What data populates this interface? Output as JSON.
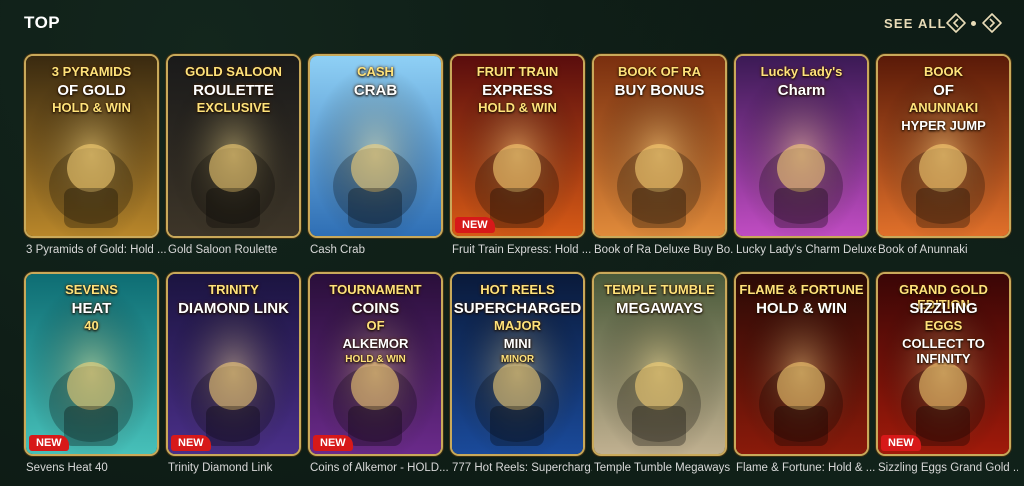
{
  "header": {
    "title": "TOP",
    "see_all": "SEE ALL",
    "accent_color": "#e9dcb8"
  },
  "badge_new": "NEW",
  "games": [
    {
      "name": "3 Pyramids of Gold: Hold ...",
      "logo": [
        "3 PYRAMIDS",
        "OF GOLD",
        "HOLD & WIN"
      ],
      "bg": [
        "#3a2a10",
        "#b8862a"
      ],
      "new": false,
      "icon": "pharaoh-art"
    },
    {
      "name": "Gold Saloon Roulette",
      "logo": [
        "GOLD SALOON",
        "ROULETTE",
        "EXCLUSIVE"
      ],
      "bg": [
        "#1a1a1a",
        "#3d3528"
      ],
      "new": false,
      "icon": "dealer-art"
    },
    {
      "name": "Cash Crab",
      "logo": [
        "CASH",
        "CRAB"
      ],
      "bg": [
        "#8fd0f5",
        "#2f6fb5"
      ],
      "new": false,
      "icon": "balls-art"
    },
    {
      "name": "Fruit Train Express: Hold ...",
      "logo": [
        "FRUIT TRAIN",
        "EXPRESS",
        "HOLD & WIN"
      ],
      "bg": [
        "#5a0d0d",
        "#d65a16"
      ],
      "new": true,
      "icon": "train-art"
    },
    {
      "name": "Book of Ra Deluxe Buy Bo...",
      "logo": [
        "BOOK OF RA",
        "BUY BONUS"
      ],
      "bg": [
        "#7a2f0f",
        "#e08a3a"
      ],
      "new": false,
      "icon": "explorer-art"
    },
    {
      "name": "Lucky Lady's Charm Deluxe",
      "logo": [
        "Lucky Lady's",
        "Charm"
      ],
      "bg": [
        "#3b1a55",
        "#c04cc2"
      ],
      "new": false,
      "icon": "lady-art"
    },
    {
      "name": "Book of Anunnaki",
      "logo": [
        "BOOK",
        "OF",
        "ANUNNAKI",
        "HYPER JUMP"
      ],
      "bg": [
        "#5a1a08",
        "#e0702a"
      ],
      "new": false,
      "icon": "anunnaki-art"
    },
    {
      "name": "Sevens Heat 40",
      "logo": [
        "SEVENS",
        "HEAT",
        "40"
      ],
      "bg": [
        "#0e6d73",
        "#47c0b9"
      ],
      "new": true,
      "icon": "dollar-art"
    },
    {
      "name": "Trinity Diamond Link",
      "logo": [
        "TRINITY",
        "DIAMOND LINK"
      ],
      "bg": [
        "#1b1440",
        "#4a2f88"
      ],
      "new": true,
      "icon": "woman-art"
    },
    {
      "name": "Coins of Alkemor - HOLD...",
      "logo": [
        "TOURNAMENT",
        "COINS",
        "OF",
        "ALKEMOR",
        "HOLD & WIN"
      ],
      "bg": [
        "#2a0f3a",
        "#6a2a8a"
      ],
      "new": true,
      "icon": "coins-art"
    },
    {
      "name": "777 Hot Reels: Supercharg...",
      "logo": [
        "HOT REELS",
        "SUPERCHARGED",
        "MAJOR",
        "MINI",
        "MINOR"
      ],
      "bg": [
        "#0a1a3a",
        "#1a4a9a"
      ],
      "new": false,
      "icon": "sevens-art"
    },
    {
      "name": "Temple Tumble Megaways",
      "logo": [
        "TEMPLE TUMBLE",
        "MEGAWAYS"
      ],
      "bg": [
        "#4a5a3a",
        "#c0b090"
      ],
      "new": false,
      "icon": "adventurer-art"
    },
    {
      "name": "Flame & Fortune: Hold & ...",
      "logo": [
        "FLAME & FORTUNE",
        "HOLD & WIN"
      ],
      "bg": [
        "#2a0a06",
        "#8a1a0a"
      ],
      "new": false,
      "icon": "dragon-art"
    },
    {
      "name": "Sizzling Eggs Grand Gold ...",
      "logo": [
        "GRAND GOLD EDITION",
        "SIZZLING",
        "EGGS",
        "COLLECT TO INFINITY"
      ],
      "bg": [
        "#3a0606",
        "#a01a0a"
      ],
      "new": true,
      "icon": "seven-art"
    }
  ]
}
